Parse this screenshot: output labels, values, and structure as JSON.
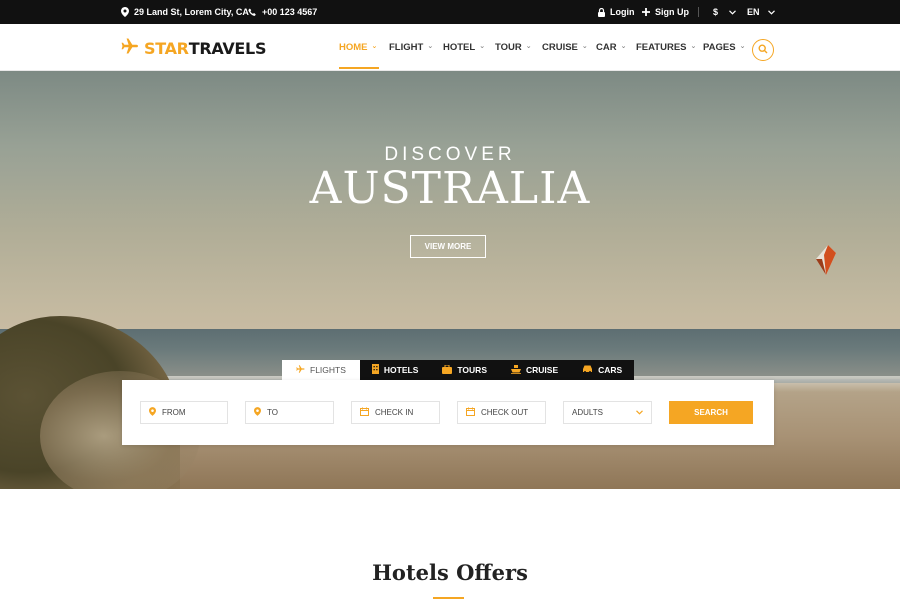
{
  "topbar": {
    "address": "29 Land St, Lorem City, CA",
    "phone": "+00 123 4567",
    "login": "Login",
    "signup": "Sign Up",
    "currency": "$",
    "language": "EN"
  },
  "brand": {
    "part1": "STAR",
    "part2": "TRAVELS",
    "accent_color": "#f5a623"
  },
  "nav": {
    "items": [
      {
        "label": "HOME",
        "active": true
      },
      {
        "label": "FLIGHT"
      },
      {
        "label": "HOTEL"
      },
      {
        "label": "TOUR"
      },
      {
        "label": "CRUISE"
      },
      {
        "label": "CAR"
      },
      {
        "label": "FEATURES"
      },
      {
        "label": "PAGES"
      }
    ],
    "search_icon": "search-icon"
  },
  "hero": {
    "subtitle": "DISCOVER",
    "title": "AUSTRALIA",
    "button": "VIEW MORE"
  },
  "search": {
    "tabs": [
      {
        "label": "FLIGHTS",
        "icon": "plane-icon",
        "active": true
      },
      {
        "label": "HOTELS",
        "icon": "hotel-icon"
      },
      {
        "label": "TOURS",
        "icon": "suitcase-icon"
      },
      {
        "label": "CRUISE",
        "icon": "ship-icon"
      },
      {
        "label": "CARS",
        "icon": "car-icon"
      }
    ],
    "fields": {
      "from": "FROM",
      "to": "TO",
      "check_in": "CHECK IN",
      "check_out": "CHECK OUT",
      "adults": "ADULTS"
    },
    "submit": "SEARCH"
  },
  "section": {
    "title": "Hotels Offers"
  }
}
